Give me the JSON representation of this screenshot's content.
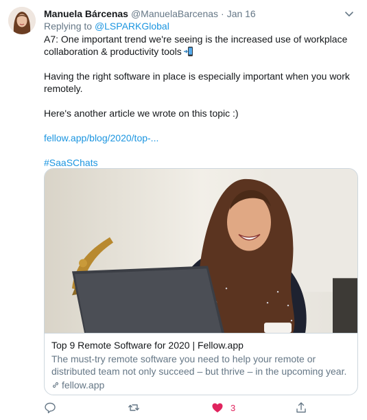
{
  "tweet": {
    "author_name": "Manuela Bárcenas",
    "author_handle": "@ManuelaBarcenas",
    "separator": "·",
    "time": "Jan 16",
    "replying_prefix": "Replying to",
    "replying_to": "@LSPARKGlobal",
    "body_line1": "A7: One important trend we're seeing is the increased use of workplace collaboration & productivity tools",
    "body_line2": "Having the right software in place is especially important when you work remotely.",
    "body_line3": "Here's another article we wrote on this topic :)",
    "link_text": "fellow.app/blog/2020/top-...",
    "hashtag": "#SaaSChats",
    "emoji_icon": "mobile-phone-arrow-icon"
  },
  "card": {
    "title": "Top 9 Remote Software for 2020 | Fellow.app",
    "description": "The must-try remote software you need to help your remote or distributed team not only succeed – but thrive – in the upcoming year.",
    "domain": "fellow.app",
    "image_icon": "woman-laughing-at-laptop-photo",
    "domain_icon": "link-icon"
  },
  "actions": {
    "reply_icon": "reply-icon",
    "retweet_icon": "retweet-icon",
    "like_icon": "heart-icon",
    "like_count": "3",
    "share_icon": "share-icon"
  },
  "colors": {
    "link_blue": "#1b95e0",
    "muted_gray": "#657786",
    "like_red": "#e0245e",
    "border": "#ccd6dd"
  }
}
